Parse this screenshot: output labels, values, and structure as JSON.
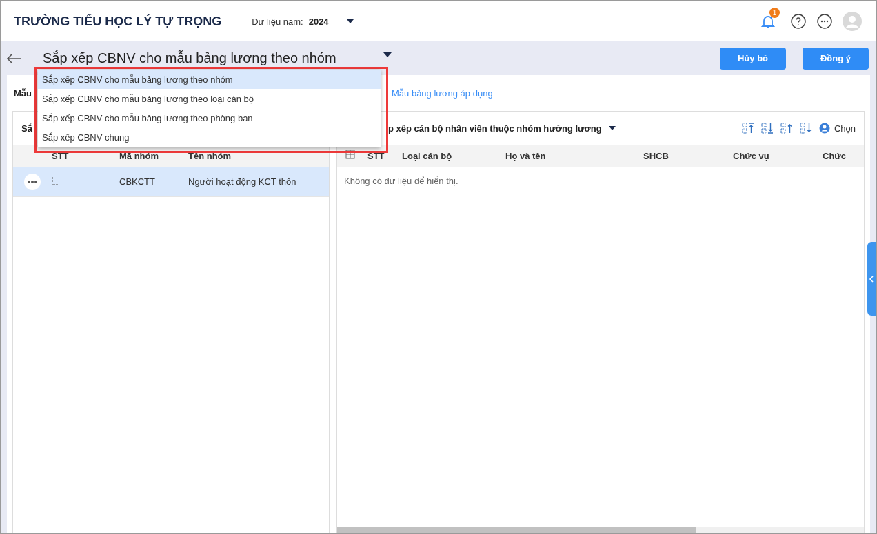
{
  "header": {
    "school": "TRƯỜNG TIỂU HỌC LÝ TỰ TRỌNG",
    "year_label": "Dữ liệu năm:",
    "year": "2024",
    "notification_count": "1"
  },
  "page": {
    "title": "Sắp xếp CBNV cho mẫu bảng lương theo nhóm",
    "buttons": [
      {
        "label": "Hủy bỏ",
        "kind": "cancel"
      },
      {
        "label": "Đồng ý",
        "kind": "ok"
      }
    ]
  },
  "mode_dropdown": {
    "options": [
      {
        "label": "Sắp xếp CBNV cho mẫu bảng lương theo nhóm",
        "selected": true
      },
      {
        "label": "Sắp xếp CBNV cho mẫu bảng lương theo loại cán bộ",
        "selected": false
      },
      {
        "label": "Sắp xếp CBNV cho mẫu bảng lương theo phòng ban",
        "selected": false
      },
      {
        "label": "Sắp xếp CBNV chung",
        "selected": false
      }
    ]
  },
  "template_label": "Mẫu",
  "template_link": "Mẫu bảng lương áp dụng",
  "left_panel": {
    "title": "Sắ",
    "columns": [
      "STT",
      "Mã nhóm",
      "Tên nhóm"
    ],
    "rows": [
      {
        "code": "CBKCTT",
        "name": "Người hoạt động KCT thôn",
        "selected": true
      }
    ]
  },
  "right_panel": {
    "title": "p xếp cán bộ nhân viên thuộc nhóm hưởng lương",
    "choose": "Chọn",
    "columns": [
      "STT",
      "Loại cán bộ",
      "Họ và tên",
      "SHCB",
      "Chức vụ",
      "Chức"
    ],
    "empty": "Không có dữ liệu để hiển thị."
  }
}
